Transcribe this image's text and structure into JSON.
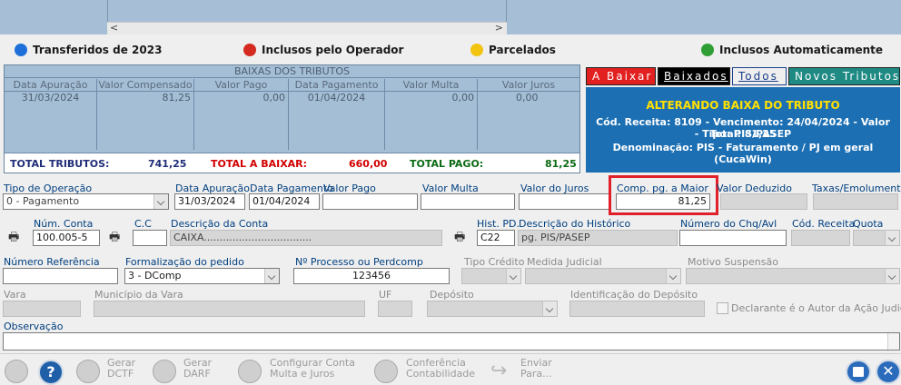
{
  "legend": [
    {
      "label": "Transferidos de 2023",
      "color": "#1e6fd9"
    },
    {
      "label": "Inclusos pelo Operador",
      "color": "#d42a1f"
    },
    {
      "label": "Parcelados",
      "color": "#f2c40f"
    },
    {
      "label": "Inclusos Automaticamente",
      "color": "#2f9e33"
    }
  ],
  "baixas": {
    "title": "BAIXAS DOS TRIBUTOS",
    "headers": [
      "Data Apuração",
      "Valor Compensado",
      "Valor Pago",
      "Data Pagamento",
      "Valor Multa",
      "Valor Juros"
    ],
    "row": [
      "31/03/2024",
      "81,25",
      "0,00",
      "01/04/2024",
      "0,00",
      "0,00"
    ],
    "totals": {
      "total_tributos_label": "TOTAL TRIBUTOS:",
      "total_tributos": "741,25",
      "total_baixar_label": "TOTAL A BAIXAR:",
      "total_baixar": "660,00",
      "total_pago_label": "TOTAL PAGO:",
      "total_pago": "81,25"
    }
  },
  "tabs": [
    "A Baixar",
    "Baixados",
    "Todos",
    "Novos Tributos"
  ],
  "info": {
    "title": "ALTERANDO BAIXA DO TRIBUTO",
    "line1": "Cód. Receita: 8109 - Vencimento: 24/04/2024 - Valor Total: 81,25",
    "line2": "- Tipo: PIS/PASEP",
    "line3": "Denominação: PIS - Faturamento / PJ em geral (CucaWin)"
  },
  "form": {
    "tipo_operacao_label": "Tipo de Operação",
    "tipo_operacao": "0 - Pagamento",
    "data_apuracao_label": "Data Apuração",
    "data_apuracao": "31/03/2024",
    "data_pagamento_label": "Data Pagamento",
    "data_pagamento": "01/04/2024",
    "valor_pago_label": "Valor Pago",
    "valor_multa_label": "Valor Multa",
    "valor_juros_label": "Valor do Juros",
    "comp_maior_label": "Comp. pg. a Maior",
    "comp_maior": "81,25",
    "valor_deduzido_label": "Valor Deduzido",
    "taxas_label": "Taxas/Emolumentos",
    "num_conta_label": "Núm. Conta",
    "num_conta": "100.005-5",
    "cc_label": "C.C",
    "desc_conta_label": "Descrição da Conta",
    "desc_conta": "CAIXA..................................",
    "hist_pd_label": "Hist. PD.",
    "hist_pd": "C22",
    "desc_hist_label": "Descrição do Histórico",
    "desc_hist": "pg. PIS/PASEP",
    "num_chq_label": "Número do Chq/Avl",
    "cod_receita_label": "Cód. Receita",
    "quota_label": "Quota",
    "num_ref_label": "Número Referência",
    "formalizacao_label": "Formalização do pedido",
    "formalizacao": "3 - DComp",
    "processo_label": "Nº Processo ou Perdcomp",
    "processo": "123456",
    "tipo_credito_label": "Tipo Crédito",
    "medida_label": "Medida Judicial",
    "motivo_label": "Motivo Suspensão",
    "vara_label": "Vara",
    "municipio_label": "Município da Vara",
    "uf_label": "UF",
    "deposito_label": "Depósito",
    "ident_deposito_label": "Identificação do Depósito",
    "declarante_label": "Declarante é o Autor da Ação Judicial",
    "observacao_label": "Observação"
  },
  "toolbar": [
    {
      "name": "gerar-dctf",
      "line1": "Gerar",
      "line2": "DCTF"
    },
    {
      "name": "gerar-darf",
      "line1": "Gerar",
      "line2": "DARF"
    },
    {
      "name": "configurar",
      "line1": "Configurar Conta",
      "line2": "Multa  e  Juros"
    },
    {
      "name": "conferencia",
      "line1": "Conferência",
      "line2": "Contabilidade"
    },
    {
      "name": "enviar",
      "line1": "Enviar",
      "line2": "Para..."
    }
  ]
}
